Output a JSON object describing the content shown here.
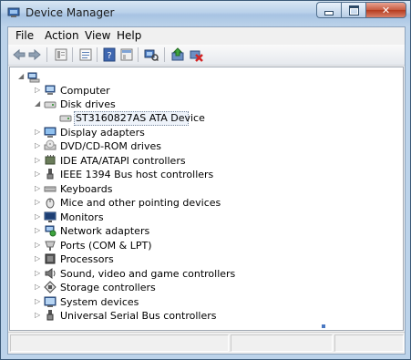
{
  "window": {
    "title": "Device Manager"
  },
  "menubar": {
    "items": [
      "File",
      "Action",
      "View",
      "Help"
    ]
  },
  "toolbar": {
    "icons": [
      "back-arrow-icon",
      "forward-arrow-icon",
      "properties-icon",
      "console-tree-icon",
      "help-icon",
      "show-hide-icon",
      "scan-hardware-icon",
      "update-driver-icon",
      "uninstall-icon"
    ]
  },
  "tree": {
    "root_label": "",
    "items": [
      {
        "label": "Computer",
        "expanded": false
      },
      {
        "label": "Disk drives",
        "expanded": true
      },
      {
        "label": "ST3160827AS ATA Device",
        "child": true,
        "selected": true
      },
      {
        "label": "Display adapters",
        "expanded": false
      },
      {
        "label": "DVD/CD-ROM drives",
        "expanded": false
      },
      {
        "label": "IDE ATA/ATAPI controllers",
        "expanded": false
      },
      {
        "label": "IEEE 1394 Bus host controllers",
        "expanded": false
      },
      {
        "label": "Keyboards",
        "expanded": false
      },
      {
        "label": "Mice and other pointing devices",
        "expanded": false
      },
      {
        "label": "Monitors",
        "expanded": false
      },
      {
        "label": "Network adapters",
        "expanded": false
      },
      {
        "label": "Ports (COM & LPT)",
        "expanded": false
      },
      {
        "label": "Processors",
        "expanded": false
      },
      {
        "label": "Sound, video and game controllers",
        "expanded": false
      },
      {
        "label": "Storage controllers",
        "expanded": false
      },
      {
        "label": "System devices",
        "expanded": false
      },
      {
        "label": "Universal Serial Bus controllers",
        "expanded": false
      }
    ]
  },
  "colors": {
    "title_gradient": "#bcd3ea",
    "close_button": "#c75a3f",
    "selection": "#eef3fa"
  }
}
